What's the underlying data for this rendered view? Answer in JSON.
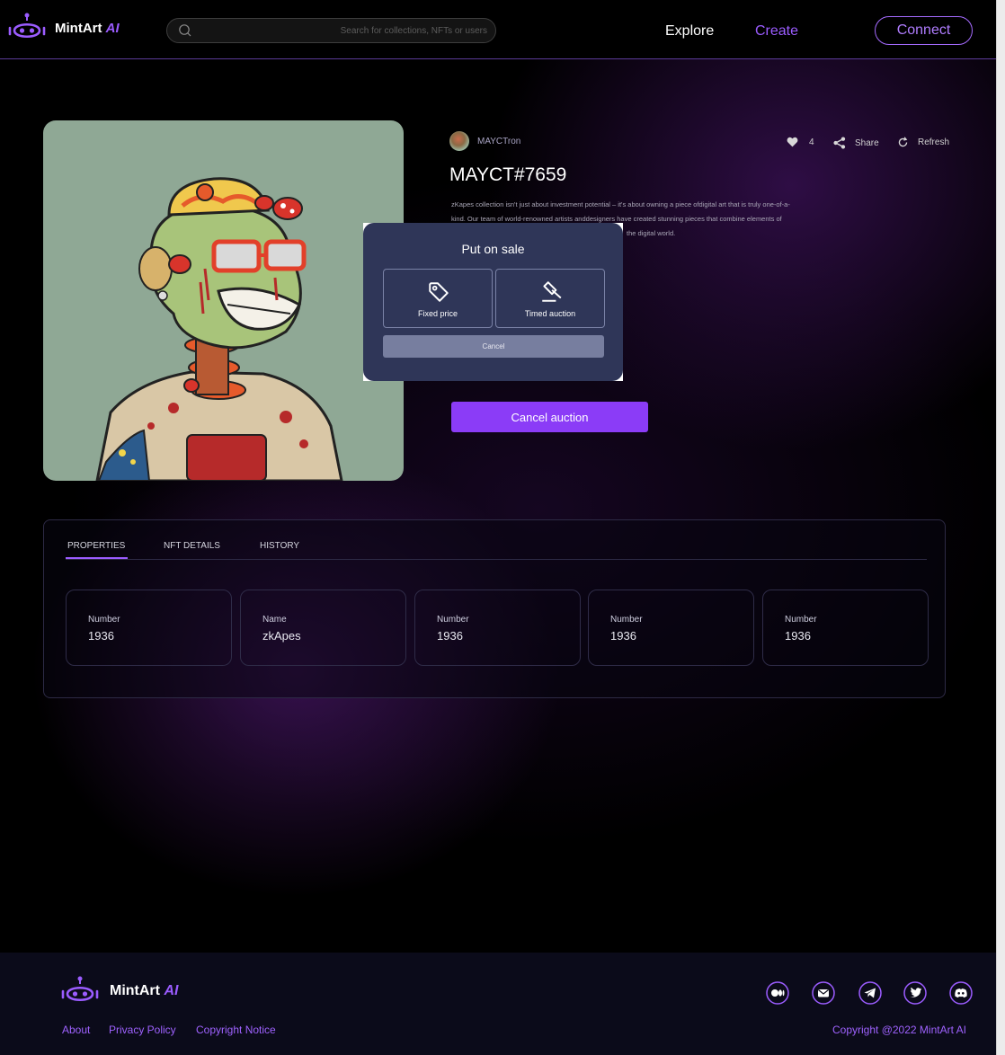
{
  "header": {
    "logo_text": "MintArt",
    "logo_suffix": "AI",
    "search_placeholder": "Search for collections, NFTs or users",
    "nav": {
      "explore": "Explore",
      "create": "Create"
    },
    "connect_label": "Connect"
  },
  "nft": {
    "creator": "MAYCTron",
    "likes": "4",
    "share_label": "Share",
    "refresh_label": "Refresh",
    "title": "MAYCT#7659",
    "description_line1": "zKapes collection isn't just about investment potential – it's about owning a piece ofdigital art that is truly one-of-a-",
    "description_line2": "kind. Our team of world-renowned artists anddesigners have created stunning pieces that combine elements of",
    "description_line3": "the digital world.",
    "cancel_auction_label": "Cancel auction"
  },
  "modal": {
    "title": "Put on sale",
    "options": [
      {
        "label": "Fixed price",
        "icon": "tag-icon"
      },
      {
        "label": "Timed auction",
        "icon": "gavel-icon"
      }
    ],
    "cancel_label": "Cancel"
  },
  "tabs": {
    "items": [
      "PROPERTIES",
      "NFT DETAILS",
      "HISTORY"
    ],
    "active": "PROPERTIES"
  },
  "properties": [
    {
      "key": "Number",
      "value": "1936"
    },
    {
      "key": "Name",
      "value": "zkApes"
    },
    {
      "key": "Number",
      "value": "1936"
    },
    {
      "key": "Number",
      "value": "1936"
    },
    {
      "key": "Number",
      "value": "1936"
    }
  ],
  "footer": {
    "logo_text": "MintArt",
    "logo_suffix": "AI",
    "links": [
      "About",
      "Privacy Policy",
      "Copyright Notice"
    ],
    "copyright": "Copyright @2022 MintArt AI",
    "social_icons": [
      "medium-icon",
      "email-icon",
      "telegram-icon",
      "twitter-icon",
      "discord-icon"
    ]
  },
  "colors": {
    "accent": "#9b5cff",
    "button": "#8b3cf7",
    "modal_bg": "#2f3658",
    "footer_bg": "#0b0b1a"
  }
}
